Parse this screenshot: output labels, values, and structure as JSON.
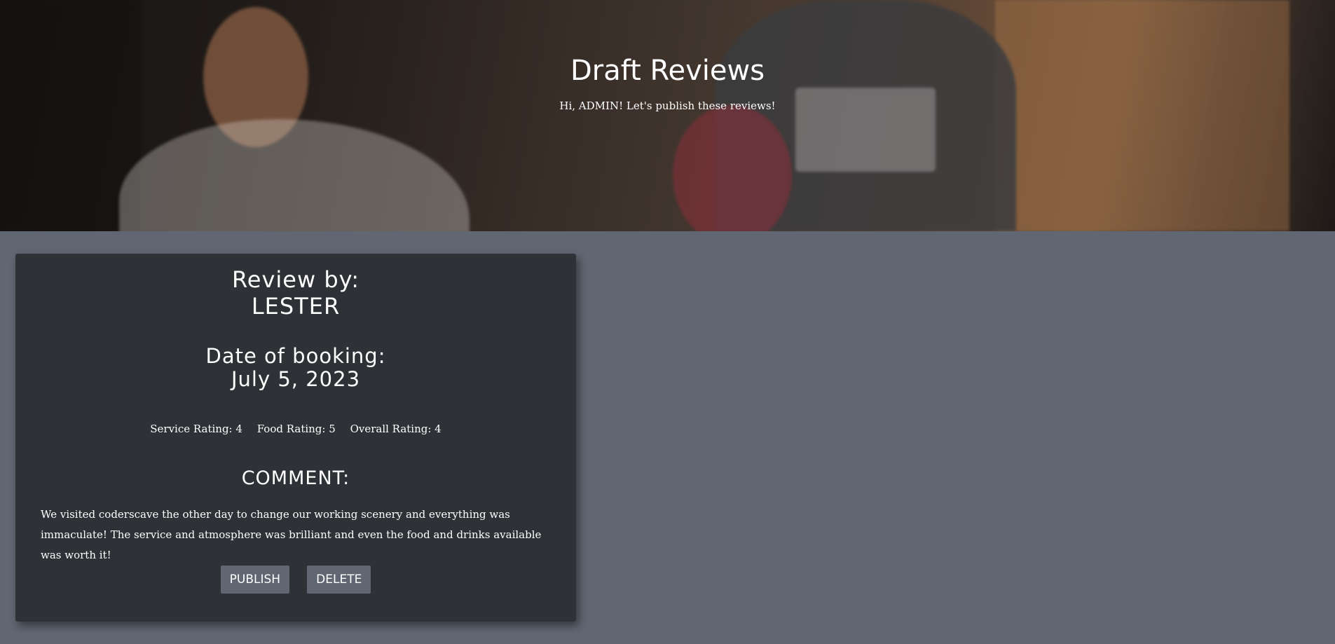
{
  "hero": {
    "title": "Draft Reviews",
    "subtitle": "Hi, ADMIN! Let's publish these reviews!"
  },
  "review": {
    "review_by_label": "Review by:",
    "reviewer": "LESTER",
    "date_label": "Date of booking:",
    "date": "July 5, 2023",
    "service_rating": "Service Rating: 4",
    "food_rating": "Food Rating: 5",
    "overall_rating": "Overall Rating: 4",
    "comment_label": "COMMENT:",
    "comment": "We visited coderscave the other day to change our working scenery and everything was immaculate! The service and atmosphere was brilliant and even the food and drinks available was worth it!",
    "publish_label": "PUBLISH",
    "delete_label": "DELETE"
  },
  "colors": {
    "page_background": "#606772",
    "card_background": "#2e3136",
    "button_background": "#606772",
    "text": "#ffffff"
  }
}
